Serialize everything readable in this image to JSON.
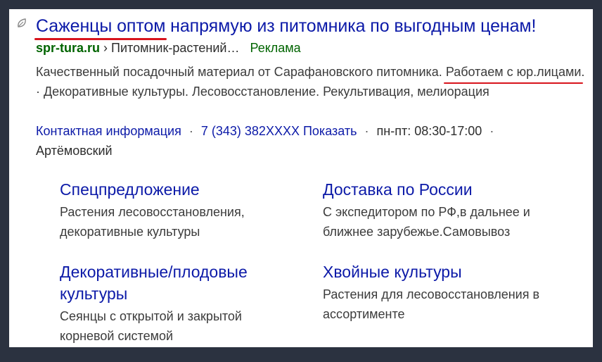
{
  "ad": {
    "title_part1": "Саженцы оптом",
    "title_part2": " напрямую из питомника по выгодным ценам!",
    "domain": "spr-tura.ru",
    "breadcrumb_separator": "›",
    "breadcrumb": "Питомник-растений…",
    "ad_label": "Реклама",
    "description_part1": "Качественный посадочный материал от Сарафановского питомника. ",
    "description_highlight": "Работаем с юр.лицами",
    "description_part2": ". · Декоративные культуры. Лесовосстановление. Рекультивация, мелиорация",
    "contact_info_label": "Контактная информация",
    "phone": "7 (343) 382XXXX",
    "show_label": "Показать",
    "hours": "пн-пт: 08:30-17:00",
    "city": "Артёмовский",
    "separator": "·"
  },
  "sitelinks": [
    {
      "title": "Спецпредложение",
      "description": "Растения лесовосстановления, декоративные культуры"
    },
    {
      "title": "Доставка по России",
      "description": "С экспедитором по РФ,в дальнее и ближнее зарубежье.Самовывоз"
    },
    {
      "title": "Декоративные/плодовые культуры",
      "description": "Сеянцы с открытой и закрытой корневой системой"
    },
    {
      "title": "Хвойные культуры",
      "description": "Растения для лесовосстановления в ассортименте"
    }
  ],
  "colors": {
    "link": "#0c1aa8",
    "domain_green": "#006400",
    "underline_red": "#d8141c",
    "frame": "#2b3240"
  },
  "icons": {
    "ad_badge": "leaf-badge-icon"
  }
}
